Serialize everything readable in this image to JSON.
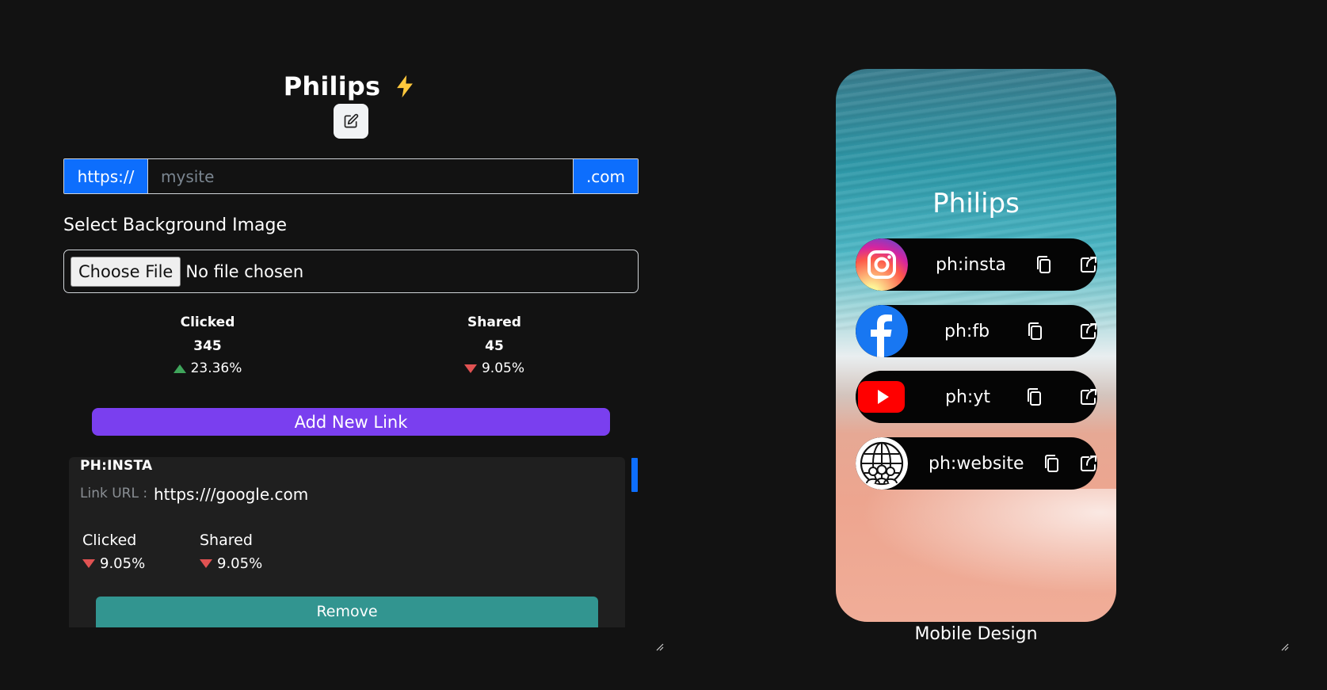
{
  "header": {
    "title": "Philips"
  },
  "url": {
    "prefix": "https://",
    "placeholder": "mysite",
    "suffix": ".com"
  },
  "background": {
    "label": "Select Background Image",
    "button": "Choose File",
    "status": "No file chosen"
  },
  "stats": [
    {
      "label": "Clicked",
      "value": "345",
      "change": "23.36%",
      "direction": "up"
    },
    {
      "label": "Shared",
      "value": "45",
      "change": "9.05%",
      "direction": "down"
    }
  ],
  "add_button": "Add New Link",
  "link_card": {
    "title": "PH:INSTA",
    "url_label": "Link URL :",
    "url": "https:///google.com",
    "clicked_label": "Clicked",
    "clicked_change": "9.05%",
    "shared_label": "Shared",
    "shared_change": "9.05%",
    "remove_label": "Remove"
  },
  "phone": {
    "name": "Philips",
    "links": [
      {
        "label": "ph:insta",
        "icon": "instagram-icon"
      },
      {
        "label": "ph:fb",
        "icon": "facebook-icon"
      },
      {
        "label": "ph:yt",
        "icon": "youtube-icon"
      },
      {
        "label": "ph:website",
        "icon": "globe-icon"
      }
    ],
    "caption": "Mobile Design"
  },
  "colors": {
    "primary": "#0d6efd",
    "add_button": "#7a3fef",
    "remove_button": "#329590",
    "up": "#3fa55b",
    "down": "#e05252"
  }
}
